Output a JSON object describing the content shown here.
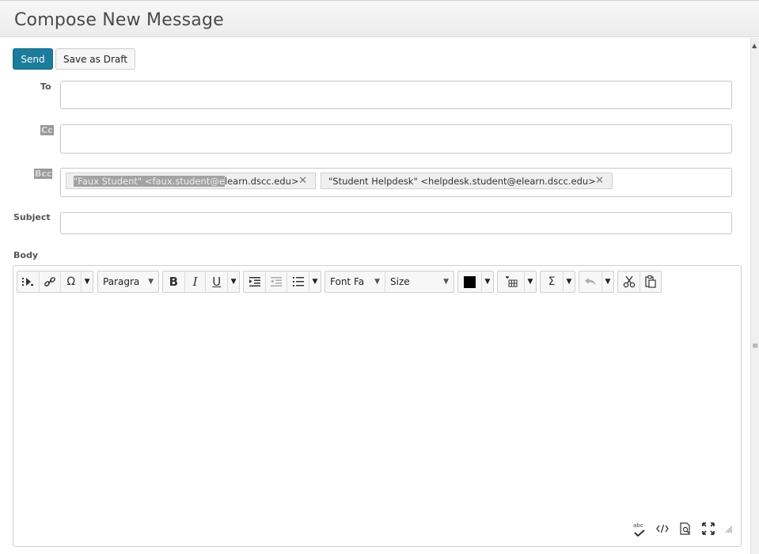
{
  "window": {
    "title": "Compose New Message"
  },
  "actions": {
    "send_label": "Send",
    "draft_label": "Save as Draft"
  },
  "fields": {
    "to_label": "To",
    "cc_label": "Cc",
    "bcc_label": "Bcc",
    "subject_label": "Subject",
    "body_label": "Body",
    "to_value": "",
    "cc_value": "",
    "subject_value": "",
    "bcc_recipients": [
      {
        "selected_text": "\"Faux Student\" <faux.student@e",
        "rest_text": "learn.dscc.edu>",
        "remove": "✕"
      },
      {
        "selected_text": "",
        "rest_text": "\"Student Helpdesk\" <helpdesk.student@elearn.dscc.edu>",
        "remove": "✕"
      }
    ]
  },
  "toolbar": {
    "icons": [
      "media-icon",
      "link-icon",
      "omega-icon",
      "bold-icon",
      "italic-icon",
      "underline-icon",
      "indent-icon",
      "outdent-icon",
      "bullet-list-icon",
      "color-swatch-icon",
      "table-icon",
      "sigma-icon",
      "undo-icon",
      "cut-icon",
      "paste-icon"
    ],
    "format_select": "Paragra",
    "font_select": "Font Fa",
    "size_select": "Size",
    "bold": "B",
    "italic": "I",
    "underline": "U",
    "omega": "Ω",
    "sigma": "Σ",
    "text_color": "#000000"
  },
  "status_bar": {
    "icons": [
      "spellcheck-icon",
      "source-code-icon",
      "preview-icon",
      "fullscreen-icon",
      "resize-handle-icon"
    ],
    "spellcheck_glyph": "abc"
  },
  "colors": {
    "send_button": "#1c7c9c",
    "selection": "#a3a3a3"
  }
}
